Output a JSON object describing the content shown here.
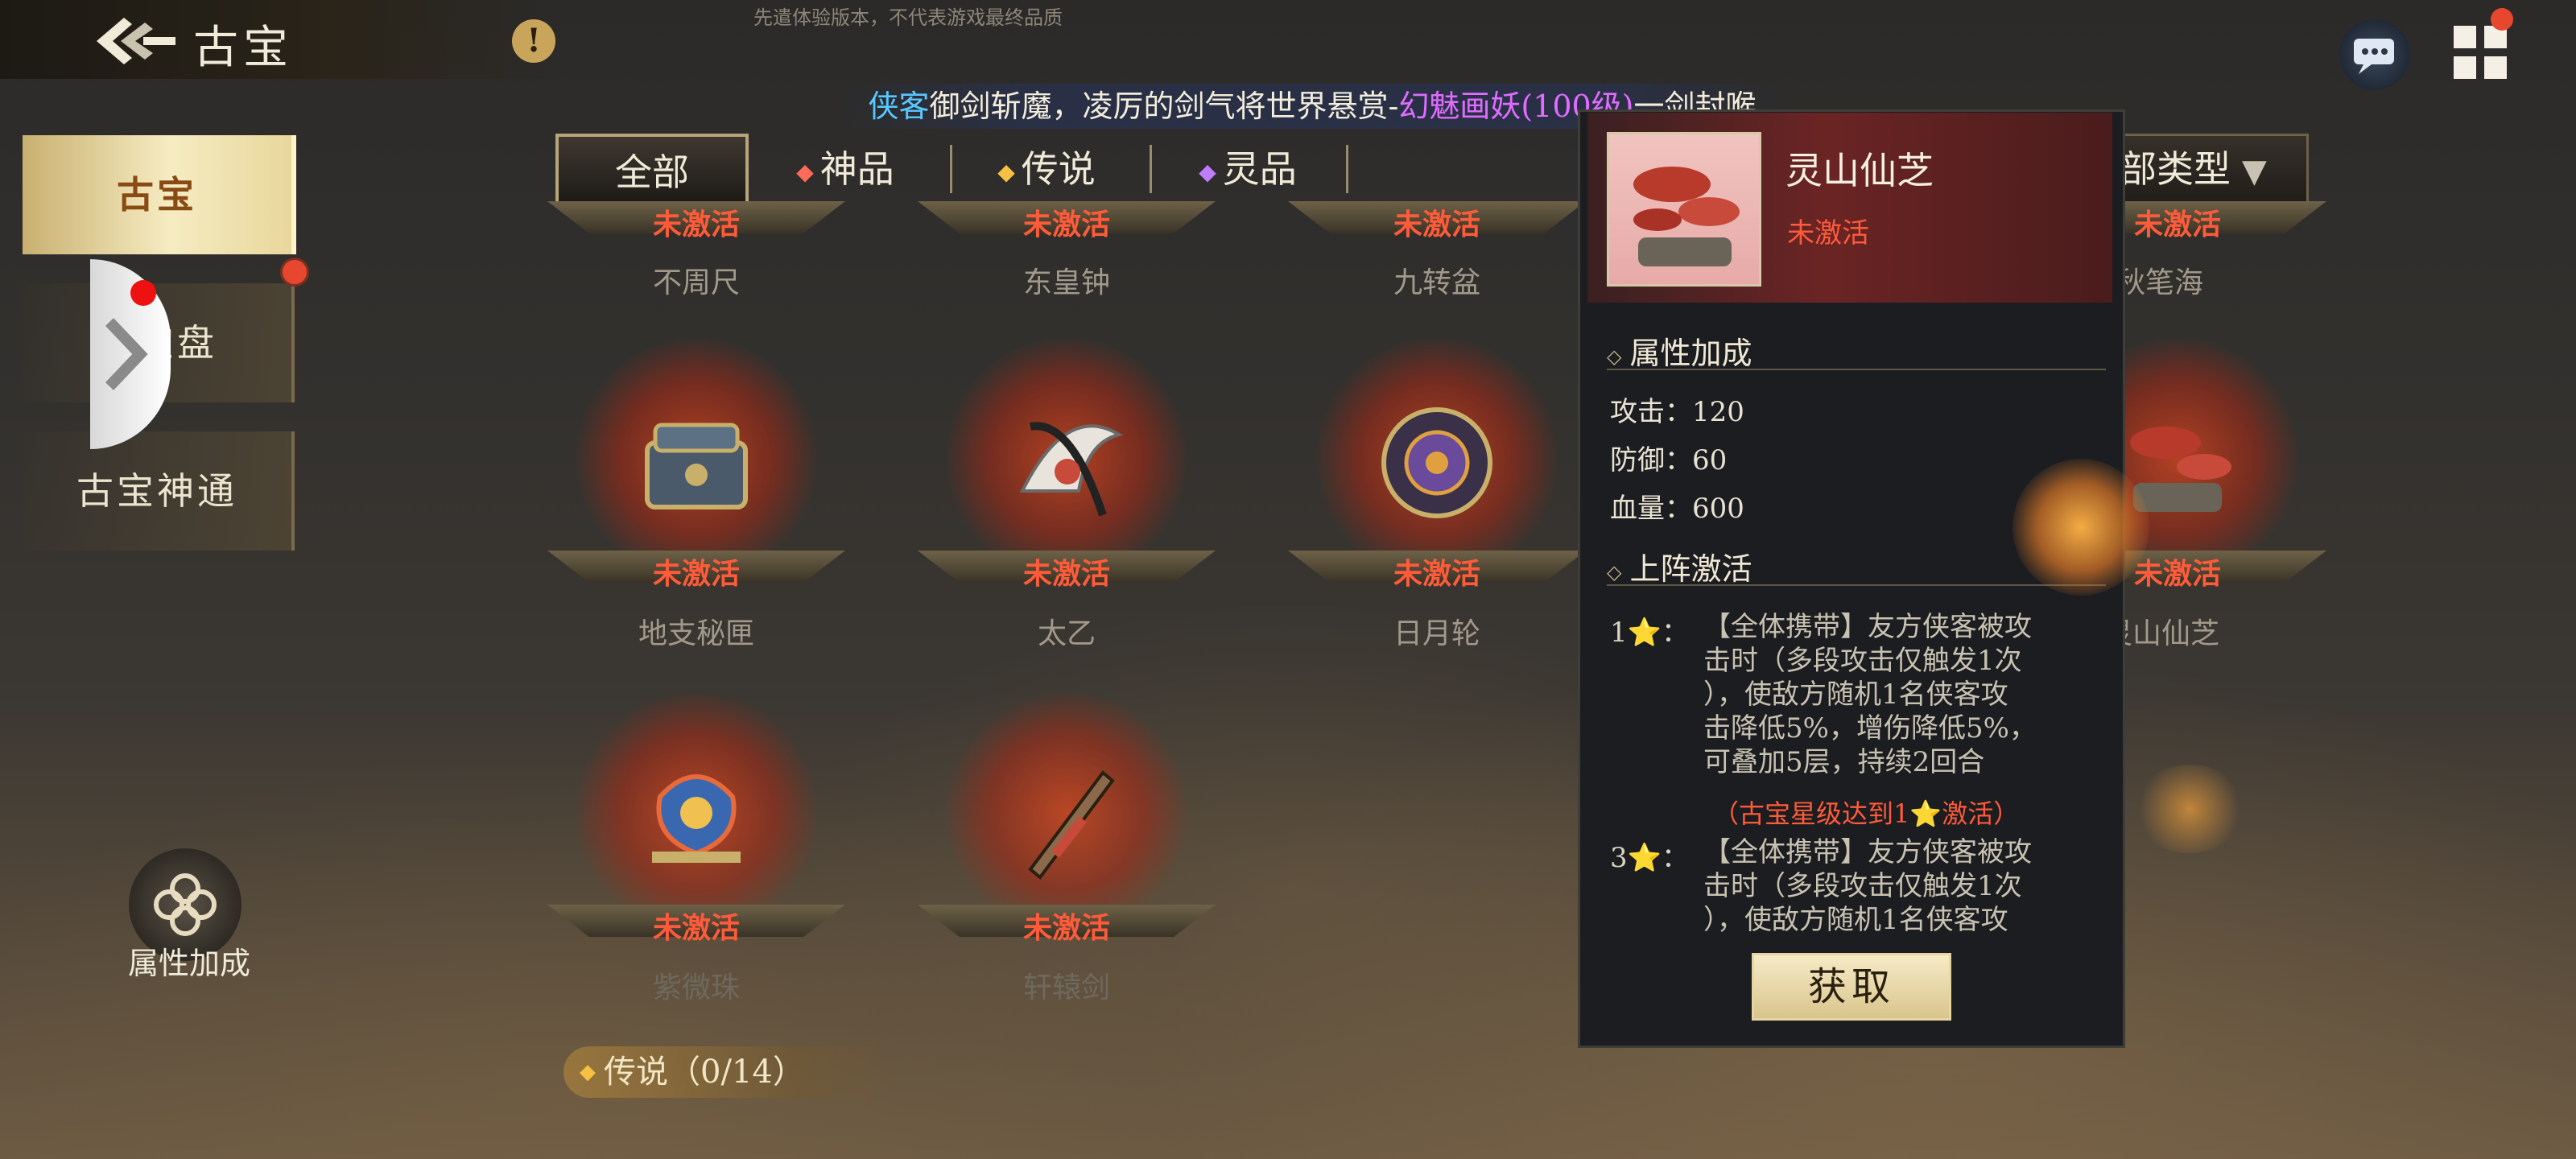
{
  "header": {
    "title": "古宝",
    "watermark": "先遣体验版本，不代表游戏最终品质"
  },
  "broadcast": {
    "hero": "侠客",
    "text1": "御剑斩魔，凌厉的剑气将世界悬赏-",
    "boss": "幻魅画妖(100级)",
    "text2": "一剑封喉"
  },
  "sidebar": {
    "items": [
      {
        "label": "古宝"
      },
      {
        "label": "古宝盘"
      },
      {
        "label": "古宝神通"
      }
    ],
    "attr_label": "属性加成"
  },
  "filters": {
    "tabs": [
      {
        "label": "全部"
      },
      {
        "label": "神品",
        "dot_color": "#ff6b5a"
      },
      {
        "label": "传说",
        "dot_color": "#f5c043"
      },
      {
        "label": "灵品",
        "dot_color": "#c07cff"
      }
    ],
    "type_dropdown": "部类型"
  },
  "items": [
    {
      "name": "不周尺",
      "status": "未激活"
    },
    {
      "name": "东皇钟",
      "status": "未激活"
    },
    {
      "name": "九转盆",
      "status": "未激活"
    },
    {
      "name": "千秋笔海",
      "status": "未激活"
    },
    {
      "name": "地支秘匣",
      "status": "未激活"
    },
    {
      "name": "太乙",
      "status": "未激活"
    },
    {
      "name": "日月轮",
      "status": "未激活"
    },
    {
      "name": "灵山仙芝",
      "status": "未激活"
    },
    {
      "name": "紫微珠",
      "status": "未激活"
    },
    {
      "name": "轩辕剑",
      "status": "未激活"
    }
  ],
  "section_legend": "传说（0/14）",
  "detail": {
    "name": "灵山仙芝",
    "status": "未激活",
    "attr_header": "属性加成",
    "stats": [
      {
        "label": "攻击：120"
      },
      {
        "label": "防御：60"
      },
      {
        "label": "血量：600"
      }
    ],
    "skills_header": "上阵激活",
    "skills": [
      {
        "star": "1⭐：",
        "lines": [
          "【全体携带】友方侠客被攻",
          "击时（多段攻击仅触发1次",
          "），使敌方随机1名侠客攻",
          "击降低5%，增伤降低5%，",
          "可叠加5层，持续2回合"
        ],
        "condition": "（古宝星级达到1⭐激活）"
      },
      {
        "star": "3⭐：",
        "lines": [
          "【全体携带】友方侠客被攻",
          "击时（多段攻击仅触发1次",
          "），使敌方随机1名侠客攻"
        ]
      }
    ],
    "get_button": "获取"
  },
  "colors": {
    "status_red": "#ff5b3a",
    "gold": "#f5c043",
    "panel_bg": "#1c1d20"
  }
}
